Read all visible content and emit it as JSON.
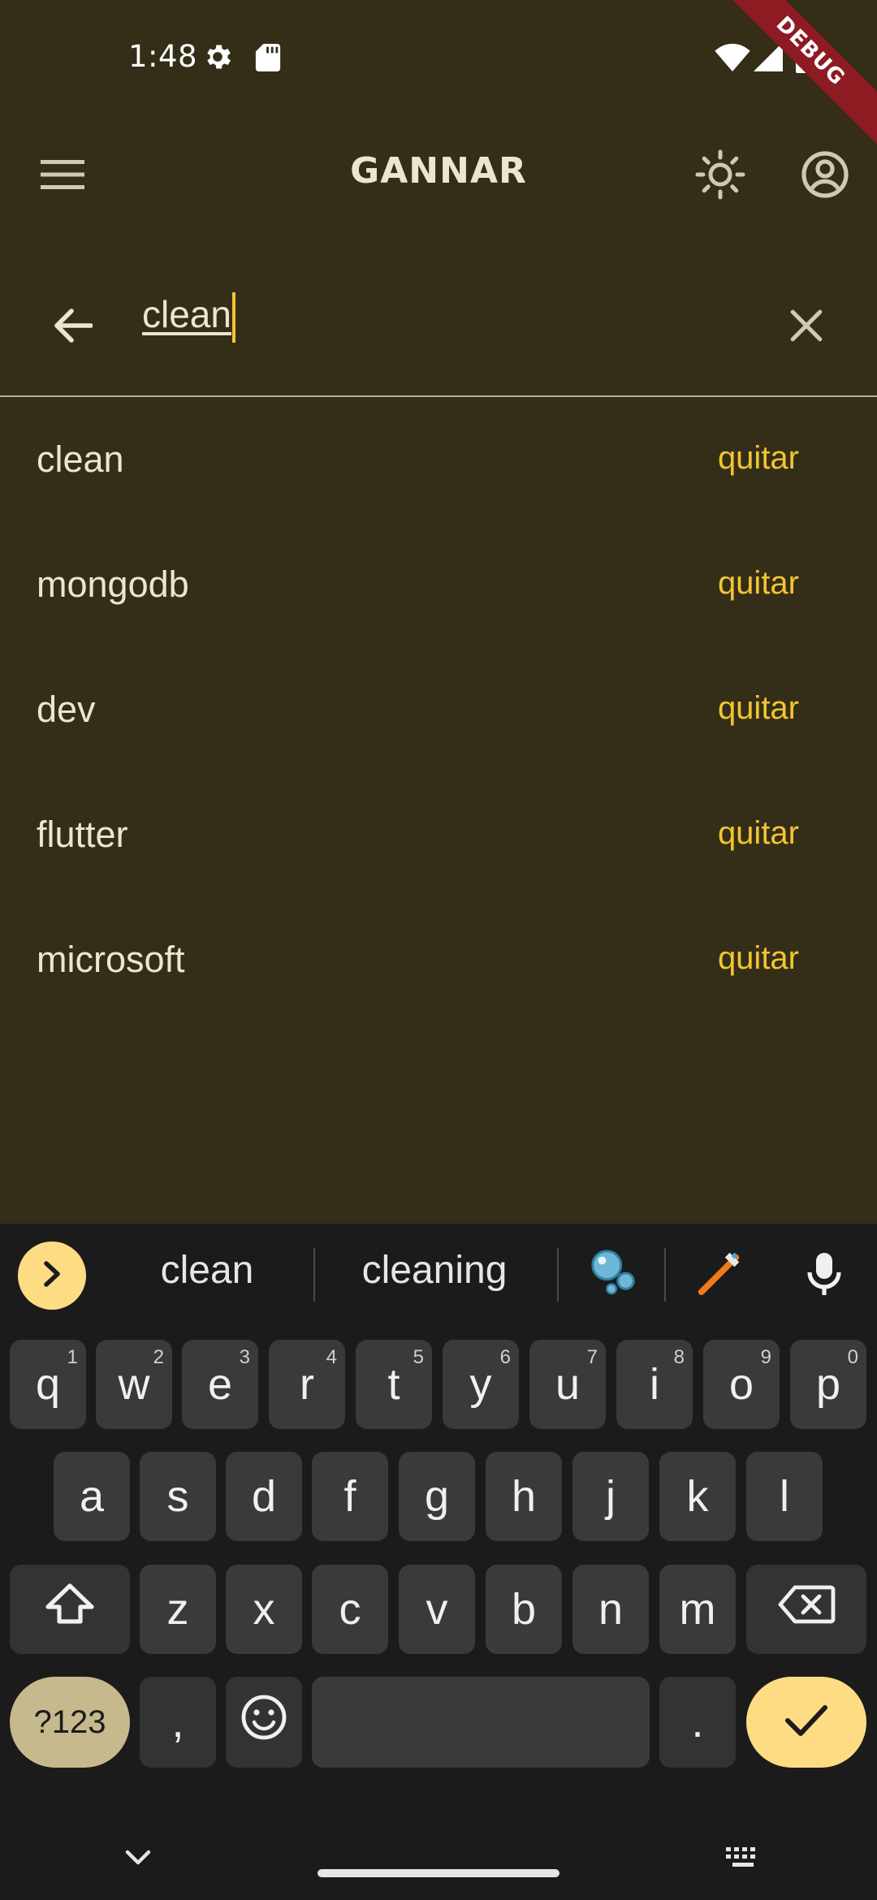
{
  "status_bar": {
    "time": "1:48",
    "debug_label": "DEBUG",
    "icons": [
      "settings-gear-icon",
      "sd-card-icon",
      "wifi-icon",
      "cell-signal-icon",
      "battery-icon"
    ]
  },
  "app_bar": {
    "title": "GANNAR",
    "icons": [
      "menu-icon",
      "brightness-icon",
      "account-circle-icon"
    ]
  },
  "search": {
    "value": "clean",
    "back_icon": "arrow-back-icon",
    "clear_icon": "close-icon"
  },
  "results": [
    {
      "term": "clean",
      "action": "quitar"
    },
    {
      "term": "mongodb",
      "action": "quitar"
    },
    {
      "term": "dev",
      "action": "quitar"
    },
    {
      "term": "flutter",
      "action": "quitar"
    },
    {
      "term": "microsoft",
      "action": "quitar"
    }
  ],
  "keyboard": {
    "suggestions": [
      "clean",
      "cleaning"
    ],
    "emoji_suggestions": [
      "bubbles-emoji",
      "toothbrush-emoji"
    ],
    "row1": [
      {
        "key": "q",
        "hint": "1"
      },
      {
        "key": "w",
        "hint": "2"
      },
      {
        "key": "e",
        "hint": "3"
      },
      {
        "key": "r",
        "hint": "4"
      },
      {
        "key": "t",
        "hint": "5"
      },
      {
        "key": "y",
        "hint": "6"
      },
      {
        "key": "u",
        "hint": "7"
      },
      {
        "key": "i",
        "hint": "8"
      },
      {
        "key": "o",
        "hint": "9"
      },
      {
        "key": "p",
        "hint": "0"
      }
    ],
    "row2": [
      "a",
      "s",
      "d",
      "f",
      "g",
      "h",
      "j",
      "k",
      "l"
    ],
    "row3": [
      "z",
      "x",
      "c",
      "v",
      "b",
      "n",
      "m"
    ],
    "symbols_label": "?123",
    "comma_label": ",",
    "period_label": "."
  },
  "colors": {
    "app_background": "#342e18",
    "accent": "#f2c531",
    "text": "#ece6d0",
    "keyboard_background": "#1b1b1b",
    "key": "#3a3a3a",
    "enter_key": "#fddc84",
    "debug_ribbon": "#8e1a22"
  }
}
